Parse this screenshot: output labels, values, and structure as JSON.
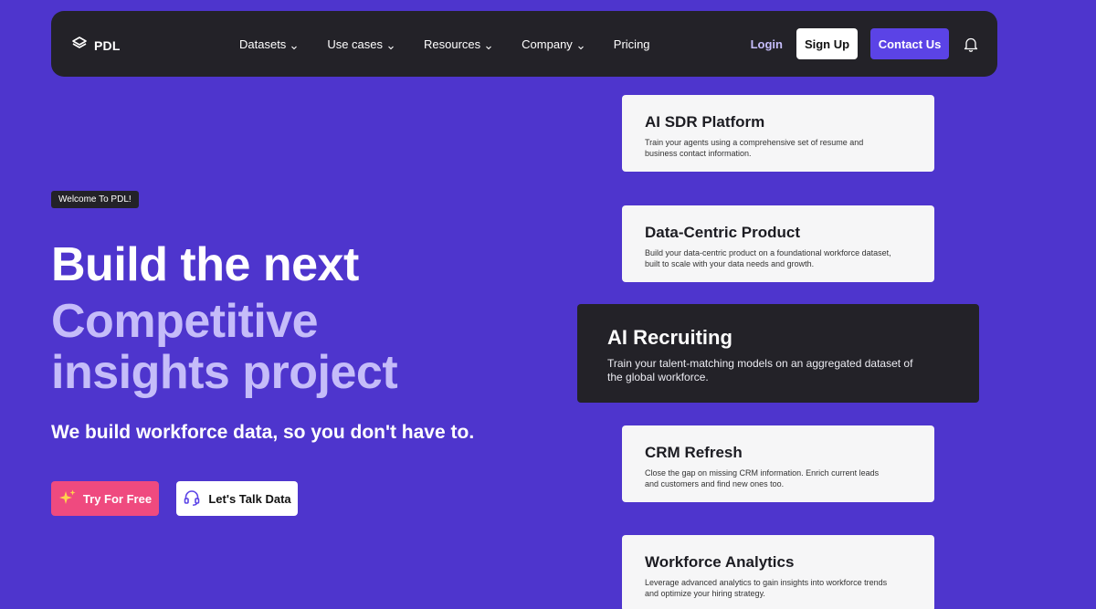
{
  "brand": {
    "name": "PDL"
  },
  "nav": {
    "items": [
      {
        "label": "Datasets",
        "has_dropdown": true
      },
      {
        "label": "Use cases",
        "has_dropdown": true
      },
      {
        "label": "Resources",
        "has_dropdown": true
      },
      {
        "label": "Company",
        "has_dropdown": true
      },
      {
        "label": "Pricing",
        "has_dropdown": false
      }
    ],
    "login": "Login",
    "signup": "Sign Up",
    "contact": "Contact Us",
    "bell_icon": "bell-icon"
  },
  "hero": {
    "badge": "Welcome To PDL!",
    "headline_line1": "Build the next",
    "headline_line2": "Competitive",
    "headline_line3": "insights project",
    "tagline": "We build workforce data, so you don't have to.",
    "try_button": "Try For Free",
    "talk_button": "Let's Talk Data",
    "try_icon": "sparkle-icon",
    "talk_icon": "headset-icon"
  },
  "cards": [
    {
      "title": "AI SDR Platform",
      "desc": "Train your agents using a comprehensive set of resume and business contact information."
    },
    {
      "title": "Data-Centric Product",
      "desc": "Build your data-centric product on a foundational workforce dataset, built to scale with your data needs and growth."
    },
    {
      "title": "AI Recruiting",
      "desc": "Train your talent-matching models on an aggregated dataset of the global workforce."
    },
    {
      "title": "CRM Refresh",
      "desc": "Close the gap on missing CRM information. Enrich current leads and customers and find new ones too."
    },
    {
      "title": "Workforce Analytics",
      "desc": "Leverage advanced analytics to gain insights into workforce trends and optimize your hiring strategy."
    }
  ],
  "colors": {
    "background": "#4e35cd",
    "navbar": "#232228",
    "accent": "#5b43e6",
    "headline_light": "#c5bcf9",
    "try_button": "#ef4a7f"
  }
}
